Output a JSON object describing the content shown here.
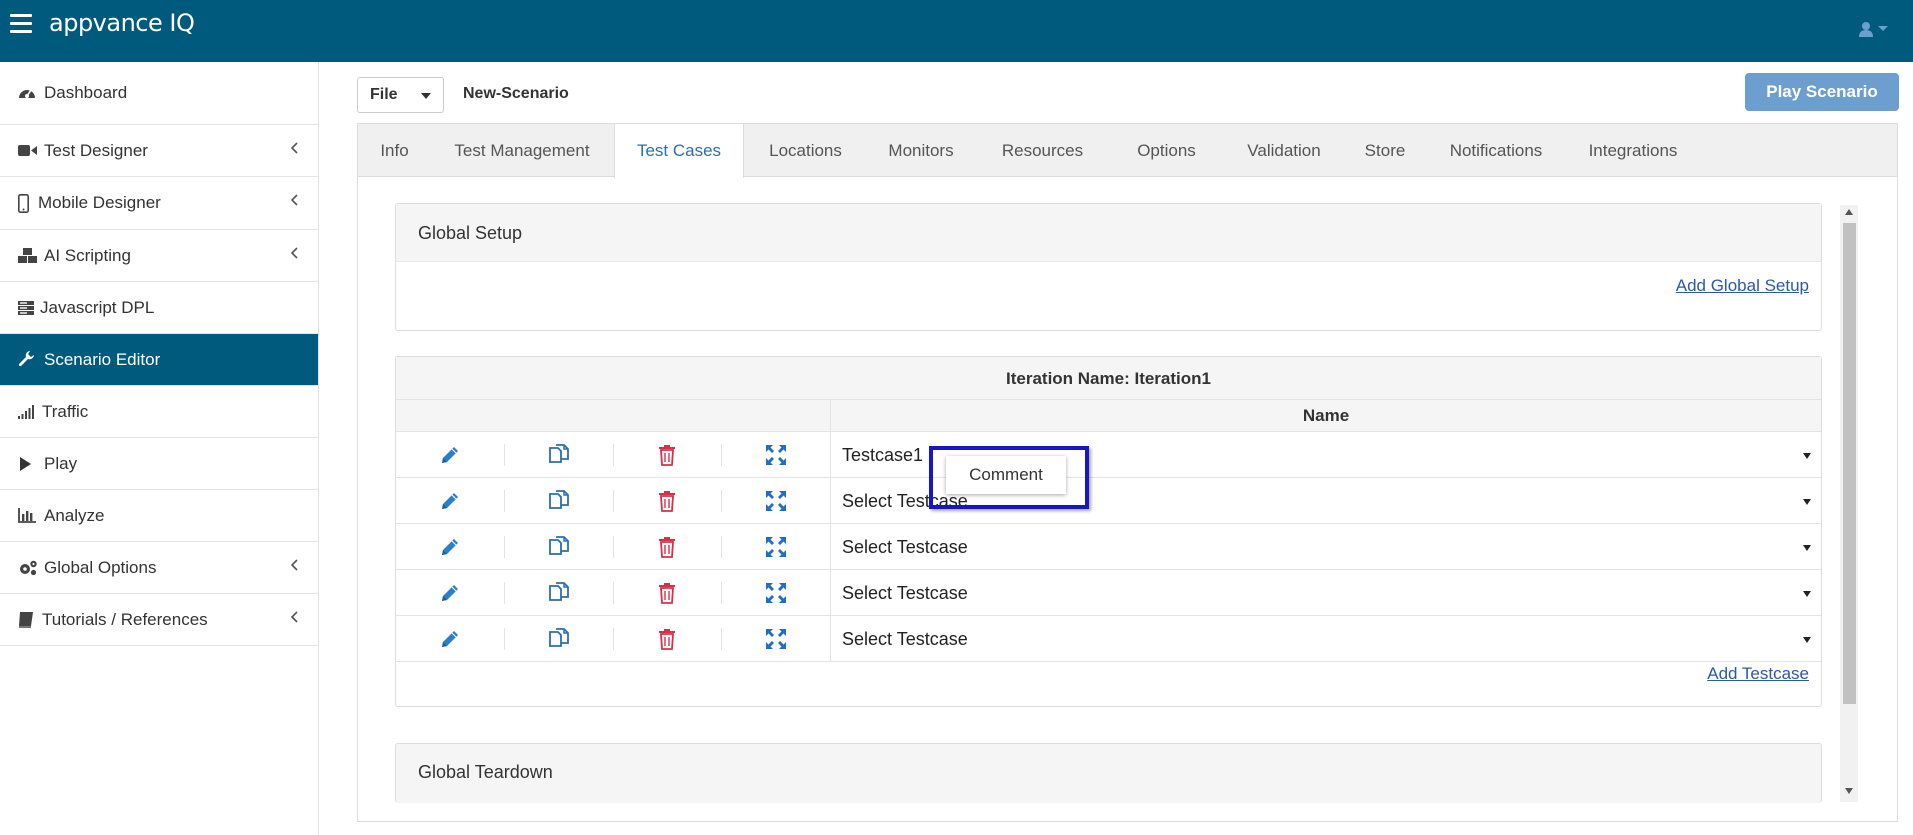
{
  "header": {
    "logo": "appvance IQ",
    "menu_icon": "hamburger-icon",
    "user_icon": "user-icon"
  },
  "sidebar": {
    "items": [
      {
        "label": "Dashboard",
        "icon": "dashboard-icon",
        "expandable": false,
        "active": false
      },
      {
        "label": "Test Designer",
        "icon": "video-camera-icon",
        "expandable": true,
        "active": false
      },
      {
        "label": "Mobile Designer",
        "icon": "mobile-icon",
        "expandable": true,
        "active": false
      },
      {
        "label": "AI Scripting",
        "icon": "cubes-icon",
        "expandable": true,
        "active": false
      },
      {
        "label": "Javascript DPL",
        "icon": "server-icon",
        "expandable": false,
        "active": false
      },
      {
        "label": "Scenario Editor",
        "icon": "wrench-icon",
        "expandable": false,
        "active": true
      },
      {
        "label": "Traffic",
        "icon": "signal-icon",
        "expandable": false,
        "active": false
      },
      {
        "label": "Play",
        "icon": "play-icon",
        "expandable": false,
        "active": false
      },
      {
        "label": "Analyze",
        "icon": "bar-chart-icon",
        "expandable": false,
        "active": false
      },
      {
        "label": "Global Options",
        "icon": "cogs-icon",
        "expandable": true,
        "active": false
      },
      {
        "label": "Tutorials / References",
        "icon": "book-icon",
        "expandable": true,
        "active": false
      }
    ]
  },
  "toolbar": {
    "file_label": "File",
    "scenario_name": "New-Scenario",
    "play_label": "Play Scenario"
  },
  "tabs": [
    {
      "label": "Info",
      "active": false
    },
    {
      "label": "Test Management",
      "active": false
    },
    {
      "label": "Test Cases",
      "active": true
    },
    {
      "label": "Locations",
      "active": false
    },
    {
      "label": "Monitors",
      "active": false
    },
    {
      "label": "Resources",
      "active": false
    },
    {
      "label": "Options",
      "active": false
    },
    {
      "label": "Validation",
      "active": false
    },
    {
      "label": "Store",
      "active": false
    },
    {
      "label": "Notifications",
      "active": false
    },
    {
      "label": "Integrations",
      "active": false
    }
  ],
  "global_setup": {
    "title": "Global Setup",
    "add_link": "Add Global Setup"
  },
  "iteration": {
    "title": "Iteration Name: Iteration1",
    "name_header": "Name",
    "rows": [
      {
        "testcase": "Testcase1"
      },
      {
        "testcase": "Select Testcase"
      },
      {
        "testcase": "Select Testcase"
      },
      {
        "testcase": "Select Testcase"
      },
      {
        "testcase": "Select Testcase"
      }
    ],
    "add_link": "Add Testcase"
  },
  "global_teardown": {
    "title": "Global Teardown"
  },
  "popup": {
    "label": "Comment"
  },
  "colors": {
    "header_bg": "#005a7d",
    "active_nav_bg": "#005a7d",
    "active_tab_text": "#2a6eb5",
    "play_button_bg": "#6c9ecf",
    "edit_icon": "#2a7fc9",
    "copy_icon": "#2a6eb5",
    "delete_icon": "#d9304a",
    "expand_icon": "#1f6fc4",
    "popup_outline": "#1a17c2"
  }
}
